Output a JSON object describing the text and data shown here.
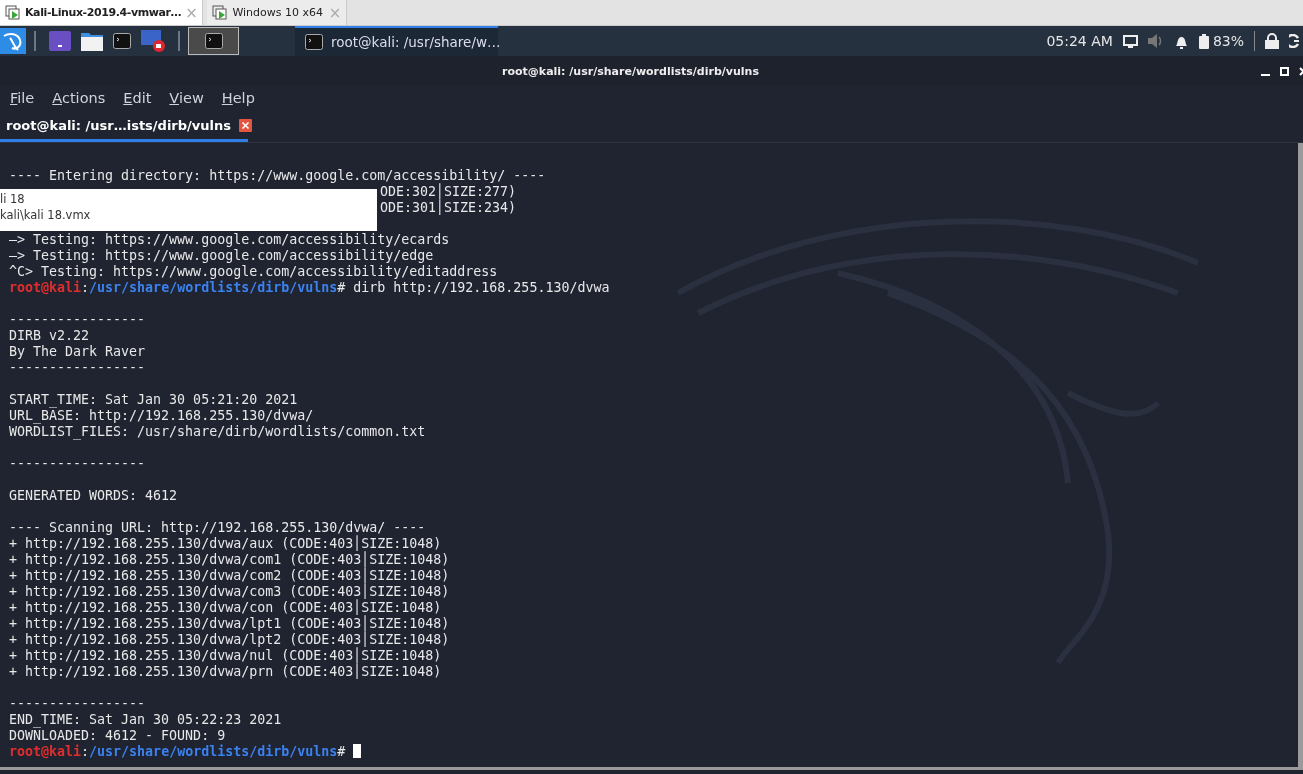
{
  "vm_tabs": [
    {
      "label": "Kali-Linux-2019.4-vmwar…",
      "close": "×",
      "selected": true
    },
    {
      "label": "Windows 10 x64",
      "close": "×",
      "selected": false
    }
  ],
  "panel": {
    "task": "root@kali: /usr/share/w…",
    "clock": "05:24 AM",
    "battery": "83%"
  },
  "window": {
    "title": "root@kali: /usr/share/wordlists/dirb/vulns"
  },
  "menu": [
    "File",
    "Actions",
    "Edit",
    "View",
    "Help"
  ],
  "tabs": [
    {
      "label": "root@kali: /usr…ists/dirb/vulns",
      "selected": true
    }
  ],
  "tooltip": {
    "lines": [
      "li 18",
      "kali\\kali 18.vmx"
    ]
  },
  "terminal": [
    {
      "kind": "blank"
    },
    {
      "kind": "text",
      "text": "---- Entering directory: https://www.google.com/accessibility/ ----"
    },
    {
      "kind": "covered",
      "text": "ODE:302│SIZE:277)"
    },
    {
      "kind": "covered",
      "text": "ODE:301│SIZE:234)"
    },
    {
      "kind": "blank"
    },
    {
      "kind": "text",
      "text": "—> Testing: https://www.google.com/accessibility/ecards"
    },
    {
      "kind": "text",
      "text": "—> Testing: https://www.google.com/accessibility/edge"
    },
    {
      "kind": "text",
      "text": "^C> Testing: https://www.google.com/accessibility/editaddress"
    },
    {
      "kind": "prompt",
      "user": "root@kali",
      "colon": ":",
      "path": "/usr/share/wordlists/dirb/vulns",
      "command": "# dirb http://192.168.255.130/dvwa"
    },
    {
      "kind": "blank"
    },
    {
      "kind": "text",
      "text": "-----------------"
    },
    {
      "kind": "text",
      "text": "DIRB v2.22"
    },
    {
      "kind": "text",
      "text": "By The Dark Raver"
    },
    {
      "kind": "text",
      "text": "-----------------"
    },
    {
      "kind": "blank"
    },
    {
      "kind": "text",
      "text": "START_TIME: Sat Jan 30 05:21:20 2021"
    },
    {
      "kind": "text",
      "text": "URL_BASE: http://192.168.255.130/dvwa/"
    },
    {
      "kind": "text",
      "text": "WORDLIST_FILES: /usr/share/dirb/wordlists/common.txt"
    },
    {
      "kind": "blank"
    },
    {
      "kind": "text",
      "text": "-----------------"
    },
    {
      "kind": "blank"
    },
    {
      "kind": "text",
      "text": "GENERATED WORDS: 4612"
    },
    {
      "kind": "blank"
    },
    {
      "kind": "text",
      "text": "---- Scanning URL: http://192.168.255.130/dvwa/ ----"
    },
    {
      "kind": "text",
      "text": "+ http://192.168.255.130/dvwa/aux (CODE:403│SIZE:1048)"
    },
    {
      "kind": "text",
      "text": "+ http://192.168.255.130/dvwa/com1 (CODE:403│SIZE:1048)"
    },
    {
      "kind": "text",
      "text": "+ http://192.168.255.130/dvwa/com2 (CODE:403│SIZE:1048)"
    },
    {
      "kind": "text",
      "text": "+ http://192.168.255.130/dvwa/com3 (CODE:403│SIZE:1048)"
    },
    {
      "kind": "text",
      "text": "+ http://192.168.255.130/dvwa/con (CODE:403│SIZE:1048)"
    },
    {
      "kind": "text",
      "text": "+ http://192.168.255.130/dvwa/lpt1 (CODE:403│SIZE:1048)"
    },
    {
      "kind": "text",
      "text": "+ http://192.168.255.130/dvwa/lpt2 (CODE:403│SIZE:1048)"
    },
    {
      "kind": "text",
      "text": "+ http://192.168.255.130/dvwa/nul (CODE:403│SIZE:1048)"
    },
    {
      "kind": "text",
      "text": "+ http://192.168.255.130/dvwa/prn (CODE:403│SIZE:1048)"
    },
    {
      "kind": "blank"
    },
    {
      "kind": "text",
      "text": "-----------------"
    },
    {
      "kind": "text",
      "text": "END_TIME: Sat Jan 30 05:22:23 2021"
    },
    {
      "kind": "text",
      "text": "DOWNLOADED: 4612 - FOUND: 9"
    },
    {
      "kind": "prompt",
      "user": "root@kali",
      "colon": ":",
      "path": "/usr/share/wordlists/dirb/vulns",
      "command": "#",
      "cursor": true
    }
  ]
}
